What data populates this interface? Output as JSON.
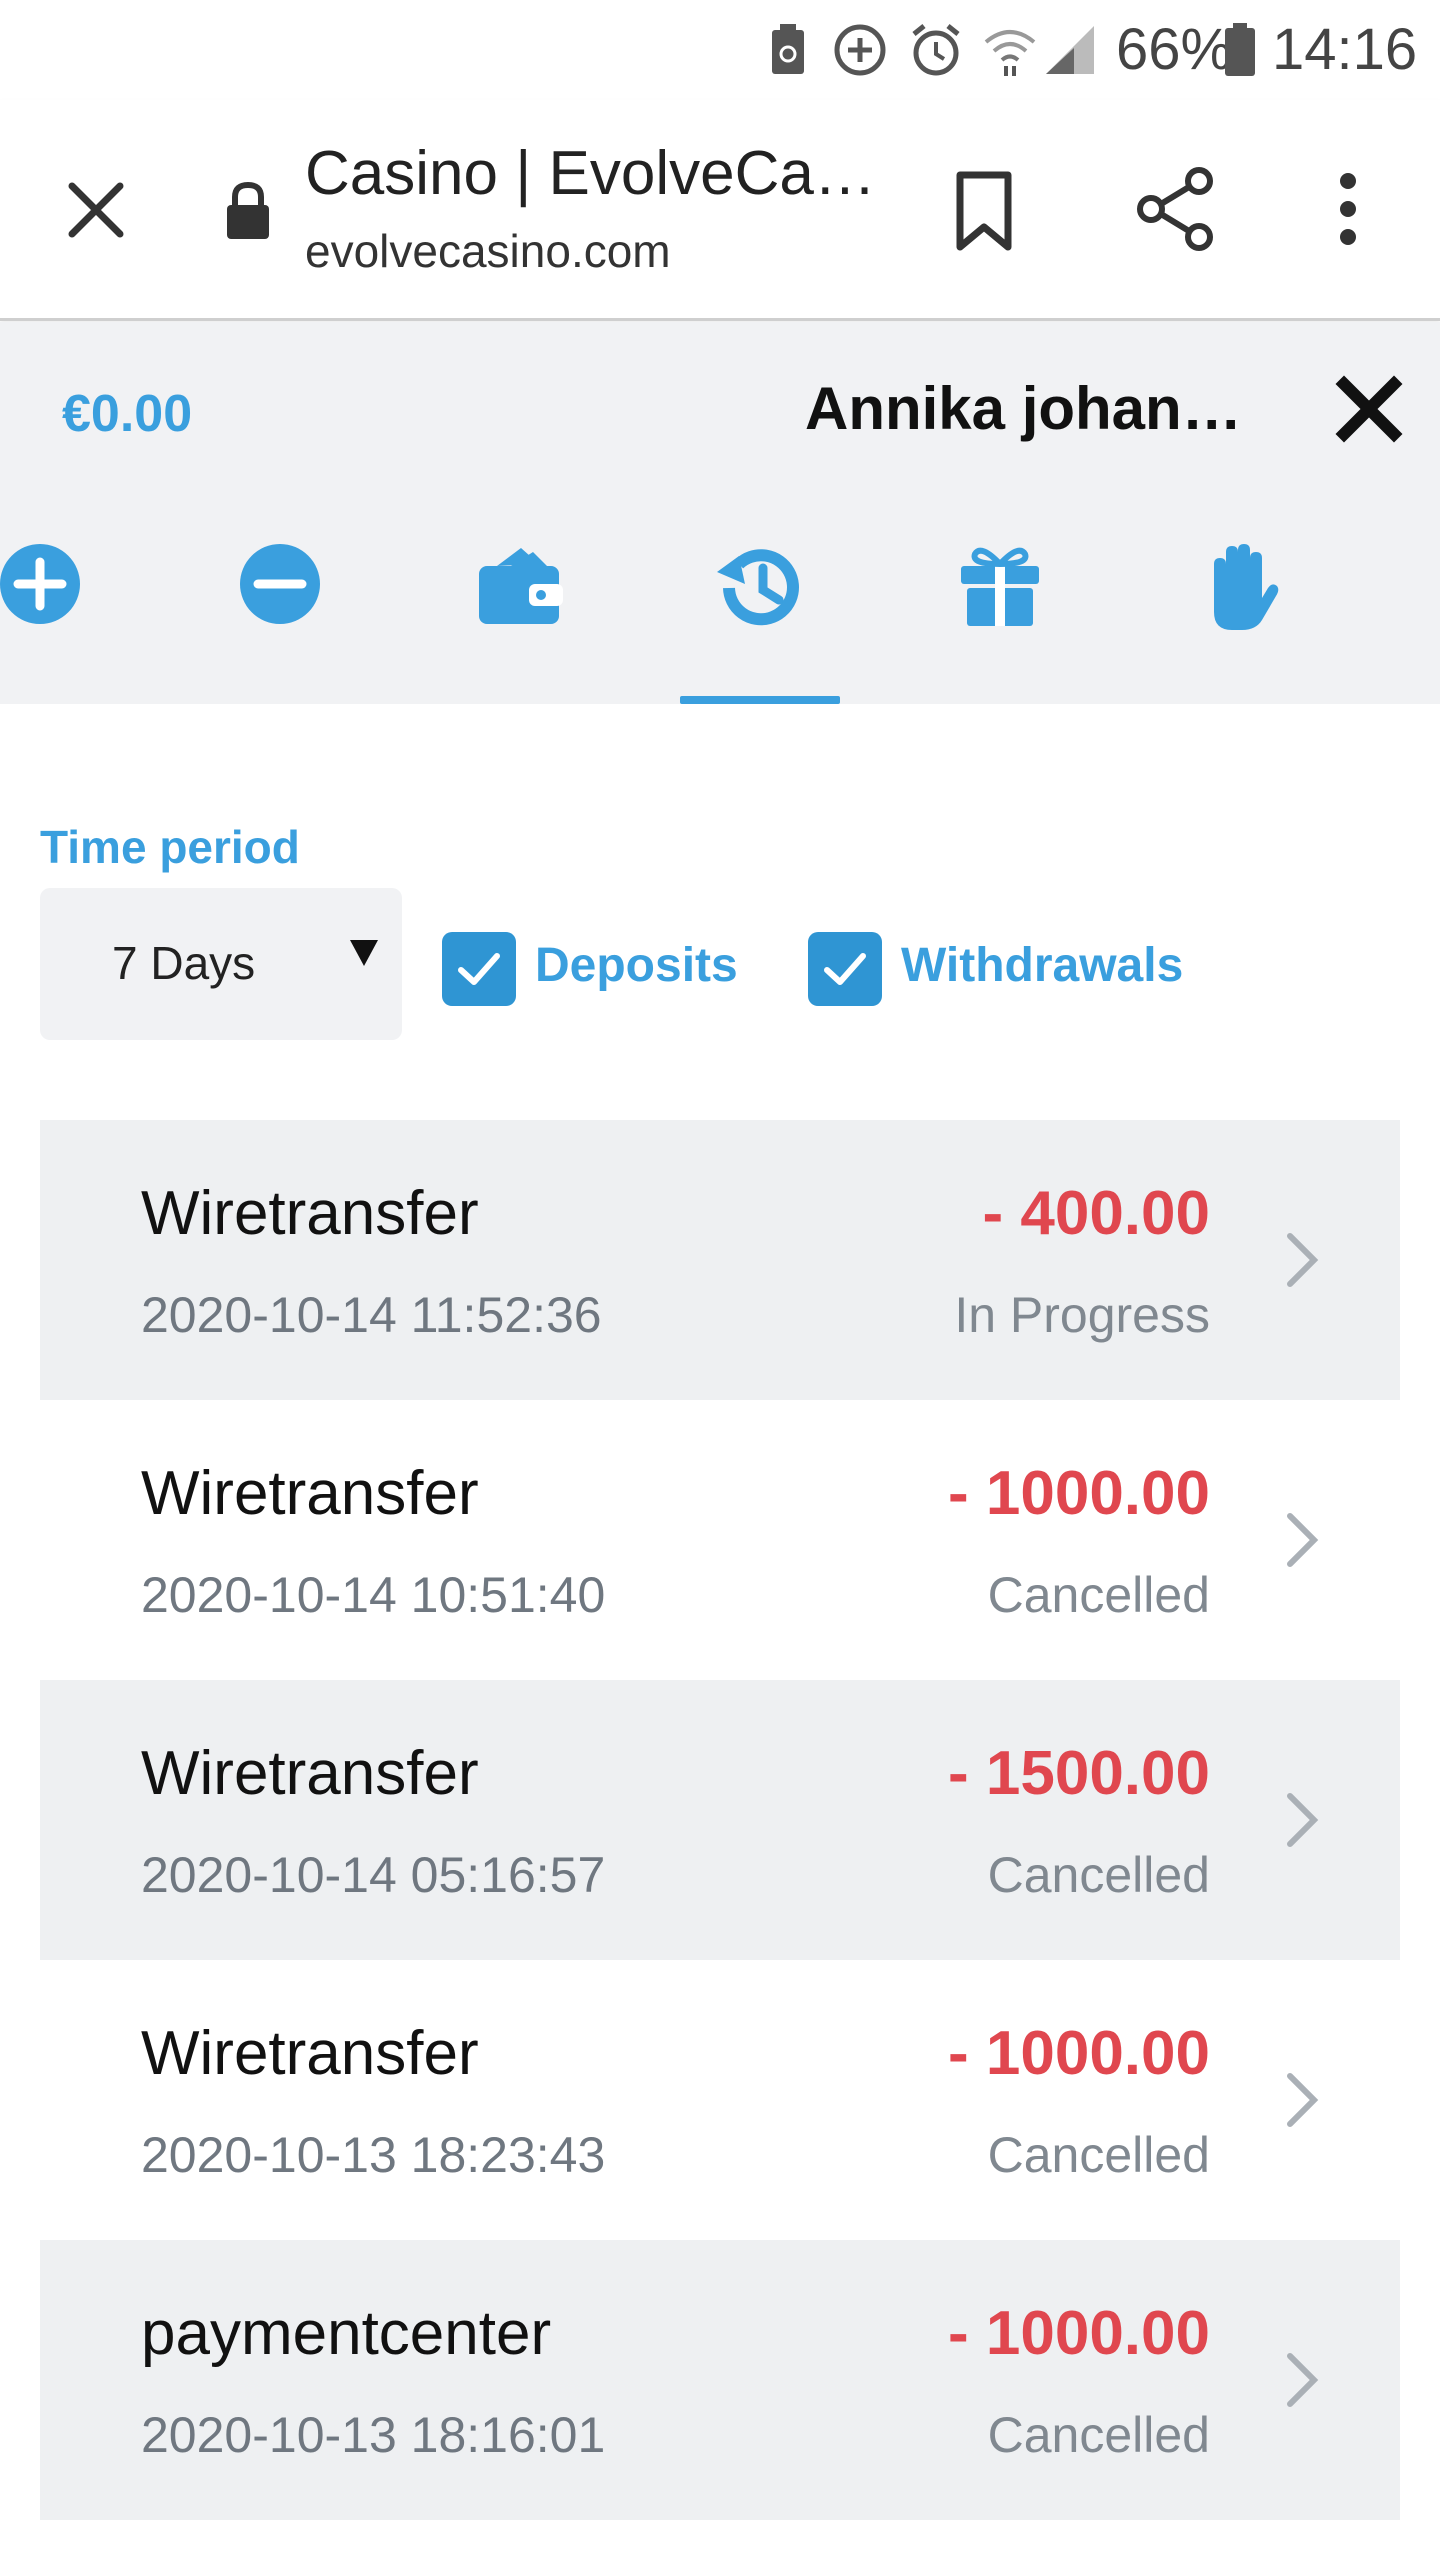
{
  "status_bar": {
    "battery_percent": "66%",
    "time": "14:16",
    "icons": [
      "storage-icon",
      "data-saver-icon",
      "alarm-icon",
      "wifi-icon",
      "signal-icon",
      "battery-icon"
    ]
  },
  "browser": {
    "page_title": "Casino | EvolveCa…",
    "url": "evolvecasino.com",
    "icons": [
      "close-icon",
      "lock-icon",
      "bookmark-icon",
      "share-icon",
      "more-vert-icon"
    ]
  },
  "account": {
    "balance": "€0.00",
    "username": "Annika johan…",
    "tabs": [
      {
        "name": "deposit",
        "icon": "plus-circle-icon"
      },
      {
        "name": "withdraw",
        "icon": "minus-circle-icon"
      },
      {
        "name": "wallet",
        "icon": "wallet-icon"
      },
      {
        "name": "history",
        "icon": "history-icon",
        "active": true
      },
      {
        "name": "bonuses",
        "icon": "gift-icon"
      },
      {
        "name": "responsible-gaming",
        "icon": "hand-icon"
      }
    ],
    "accent_color": "#3a9fde"
  },
  "filters": {
    "time_period_label": "Time period",
    "time_period_value": "7 Days",
    "deposits_label": "Deposits",
    "deposits_checked": true,
    "withdrawals_label": "Withdrawals",
    "withdrawals_checked": true
  },
  "transactions": [
    {
      "method": "Wiretransfer",
      "date": "2020-10-14 11:52:36",
      "amount": "- 400.00",
      "status": "In Progress"
    },
    {
      "method": "Wiretransfer",
      "date": "2020-10-14 10:51:40",
      "amount": "- 1000.00",
      "status": "Cancelled"
    },
    {
      "method": "Wiretransfer",
      "date": "2020-10-14 05:16:57",
      "amount": "- 1500.00",
      "status": "Cancelled"
    },
    {
      "method": "Wiretransfer",
      "date": "2020-10-13 18:23:43",
      "amount": "- 1000.00",
      "status": "Cancelled"
    },
    {
      "method": "paymentcenter",
      "date": "2020-10-13 18:16:01",
      "amount": "- 1000.00",
      "status": "Cancelled"
    }
  ],
  "colors": {
    "negative_amount": "#e0474f",
    "row_shade": "#eef0f2",
    "header_bg": "#f1f2f4"
  }
}
